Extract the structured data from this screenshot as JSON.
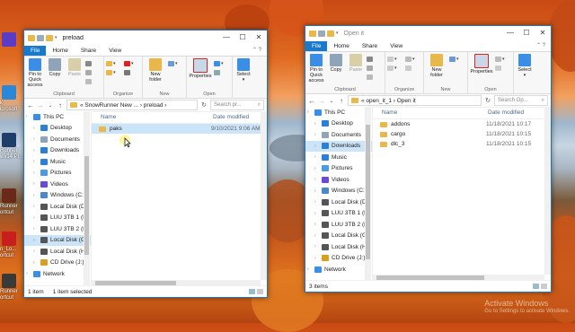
{
  "desktop": {
    "icons": [
      {
        "name": "app-icon-1",
        "label": "",
        "color": "#5b3cc4"
      },
      {
        "name": "app-icon-2",
        "label": "k\nicrosoft",
        "color": "#2b88d8"
      },
      {
        "name": "app-icon-3",
        "label": "Runner\nwv14 Pl...",
        "color": "#1f3f6a"
      },
      {
        "name": "app-icon-4",
        "label": "Runner\nortcut",
        "color": "#6a2a1a"
      },
      {
        "name": "app-icon-5",
        "label": "n_Lo...\nortcut",
        "color": "#c81e1e"
      },
      {
        "name": "app-icon-6",
        "label": "Runner\nortcut",
        "color": "#3a3a3a"
      }
    ]
  },
  "left_window": {
    "title": "preload",
    "controls": {
      "minimize": "—",
      "maximize": "☐",
      "close": "✕"
    },
    "tabs": [
      "File",
      "Home",
      "Share",
      "View"
    ],
    "ribbon": {
      "pin_label": "Pin to Quick access",
      "copy_label": "Copy",
      "paste_label": "Paste",
      "clipboard_label": "Clipboard",
      "organize_label": "Organize",
      "new_folder_label": "New folder",
      "new_label": "New",
      "properties_label": "Properties",
      "open_label": "Open",
      "select_label": "Select"
    },
    "address": {
      "path": "« SnowRunner New ... › preload ›",
      "search_placeholder": "Search pr..."
    },
    "nav": [
      {
        "label": "This PC",
        "icon": "pc-icon",
        "color": "#3a8ee6",
        "indent": 0,
        "sel": false
      },
      {
        "label": "Desktop",
        "icon": "desktop-icon",
        "color": "#2c7fd6",
        "indent": 1,
        "sel": false
      },
      {
        "label": "Documents",
        "icon": "documents-icon",
        "color": "#8fa4b8",
        "indent": 1,
        "sel": false
      },
      {
        "label": "Downloads",
        "icon": "downloads-icon",
        "color": "#2c7fd6",
        "indent": 1,
        "sel": false
      },
      {
        "label": "Music",
        "icon": "music-icon",
        "color": "#2c7fd6",
        "indent": 1,
        "sel": false
      },
      {
        "label": "Pictures",
        "icon": "pictures-icon",
        "color": "#4a9be0",
        "indent": 1,
        "sel": false
      },
      {
        "label": "Videos",
        "icon": "videos-icon",
        "color": "#6a4ad6",
        "indent": 1,
        "sel": false
      },
      {
        "label": "Windows (C:)",
        "icon": "drive-icon",
        "color": "#4a88c8",
        "indent": 1,
        "sel": false
      },
      {
        "label": "Local Disk (D:)",
        "icon": "drive-icon",
        "color": "#555555",
        "indent": 1,
        "sel": false
      },
      {
        "label": "LUU 3TB 1 (E:)",
        "icon": "drive-icon",
        "color": "#555555",
        "indent": 1,
        "sel": false
      },
      {
        "label": "LUU 3TB 2 (F:)",
        "icon": "drive-icon",
        "color": "#555555",
        "indent": 1,
        "sel": false
      },
      {
        "label": "Local Disk (G:)",
        "icon": "drive-icon",
        "color": "#555555",
        "indent": 1,
        "sel": true
      },
      {
        "label": "Local Disk (H:)",
        "icon": "drive-icon",
        "color": "#555555",
        "indent": 1,
        "sel": false
      },
      {
        "label": "CD Drive (J:)",
        "icon": "cd-icon",
        "color": "#d9a020",
        "indent": 1,
        "sel": false
      },
      {
        "label": "Network",
        "icon": "network-icon",
        "color": "#3a8ee6",
        "indent": 0,
        "sel": false
      }
    ],
    "columns": {
      "name": "Name",
      "date": "Date modified"
    },
    "rows": [
      {
        "name": "paks",
        "date": "9/10/2021 9:06 AM",
        "sel": true
      }
    ],
    "status": {
      "count": "1 item",
      "selected": "1 item selected"
    }
  },
  "right_window": {
    "title": "Open it",
    "controls": {
      "minimize": "—",
      "maximize": "☐",
      "close": "✕"
    },
    "tabs": [
      "File",
      "Home",
      "Share",
      "View"
    ],
    "ribbon": {
      "pin_label": "Pin to Quick access",
      "copy_label": "Copy",
      "paste_label": "Paste",
      "clipboard_label": "Clipboard",
      "organize_label": "Organize",
      "new_folder_label": "New folder",
      "new_label": "New",
      "properties_label": "Properties",
      "open_label": "Open",
      "select_label": "Select"
    },
    "address": {
      "path": "« open_it_1 › Open it",
      "search_placeholder": "Search Op..."
    },
    "nav": [
      {
        "label": "This PC",
        "icon": "pc-icon",
        "color": "#3a8ee6",
        "indent": 0,
        "sel": false
      },
      {
        "label": "Desktop",
        "icon": "desktop-icon",
        "color": "#2c7fd6",
        "indent": 1,
        "sel": false
      },
      {
        "label": "Documents",
        "icon": "documents-icon",
        "color": "#8fa4b8",
        "indent": 1,
        "sel": false
      },
      {
        "label": "Downloads",
        "icon": "downloads-icon",
        "color": "#2c7fd6",
        "indent": 1,
        "sel": true
      },
      {
        "label": "Music",
        "icon": "music-icon",
        "color": "#2c7fd6",
        "indent": 1,
        "sel": false
      },
      {
        "label": "Pictures",
        "icon": "pictures-icon",
        "color": "#4a9be0",
        "indent": 1,
        "sel": false
      },
      {
        "label": "Videos",
        "icon": "videos-icon",
        "color": "#6a4ad6",
        "indent": 1,
        "sel": false
      },
      {
        "label": "Windows (C:)",
        "icon": "drive-icon",
        "color": "#4a88c8",
        "indent": 1,
        "sel": false
      },
      {
        "label": "Local Disk (D:)",
        "icon": "drive-icon",
        "color": "#555555",
        "indent": 1,
        "sel": false
      },
      {
        "label": "LUU 3TB 1 (E:)",
        "icon": "drive-icon",
        "color": "#555555",
        "indent": 1,
        "sel": false
      },
      {
        "label": "LUU 3TB 2 (F:)",
        "icon": "drive-icon",
        "color": "#555555",
        "indent": 1,
        "sel": false
      },
      {
        "label": "Local Disk (G:)",
        "icon": "drive-icon",
        "color": "#555555",
        "indent": 1,
        "sel": false
      },
      {
        "label": "Local Disk (H:)",
        "icon": "drive-icon",
        "color": "#555555",
        "indent": 1,
        "sel": false
      },
      {
        "label": "CD Drive (J:)",
        "icon": "cd-icon",
        "color": "#d9a020",
        "indent": 1,
        "sel": false
      },
      {
        "label": "Network",
        "icon": "network-icon",
        "color": "#3a8ee6",
        "indent": 0,
        "sel": false
      }
    ],
    "columns": {
      "name": "Name",
      "date": "Date modified"
    },
    "rows": [
      {
        "name": "addons",
        "date": "11/18/2021 10:17",
        "sel": false
      },
      {
        "name": "cargo",
        "date": "11/18/2021 10:15",
        "sel": false
      },
      {
        "name": "dlc_3",
        "date": "11/18/2021 10:15",
        "sel": false
      }
    ],
    "status": {
      "count": "3 items",
      "selected": ""
    }
  },
  "watermark": {
    "line1": "Activate Windows",
    "line2": "Go to Settings to activate Windows."
  },
  "colors": {
    "accent": "#1979ca",
    "selection": "#cce4f7",
    "folder": "#e8b84a"
  }
}
